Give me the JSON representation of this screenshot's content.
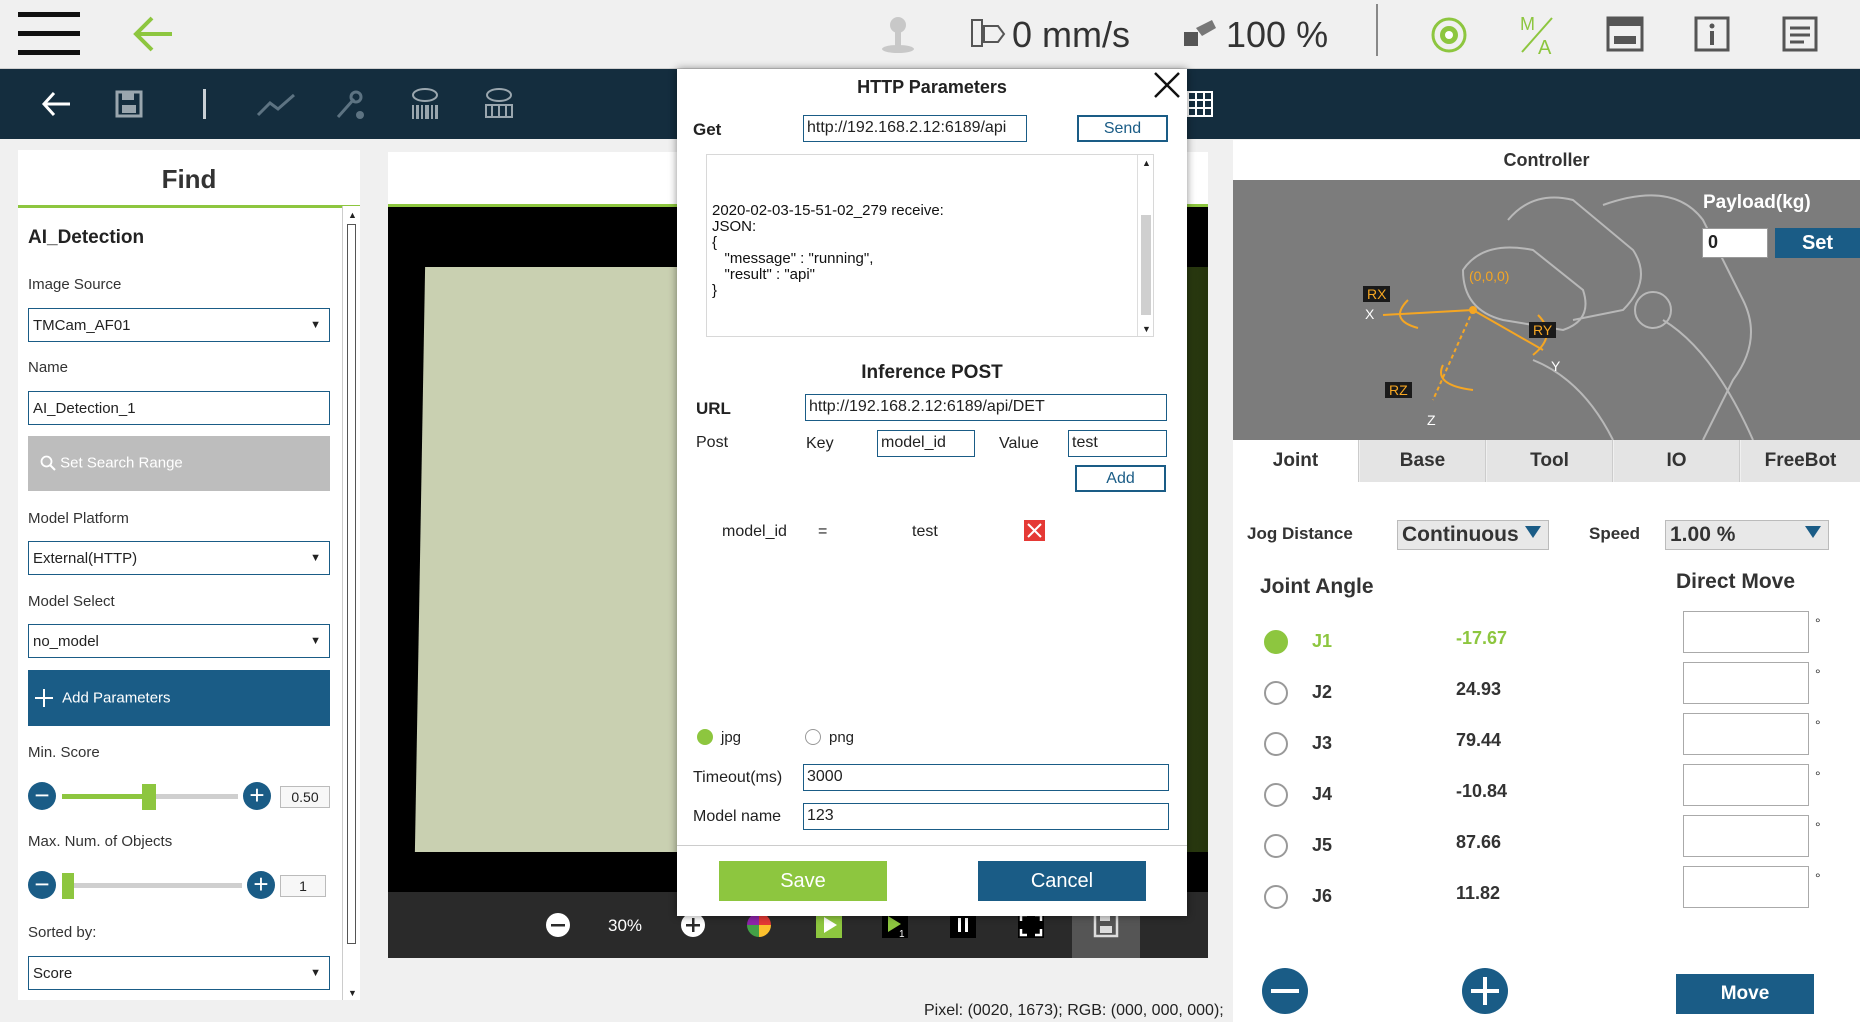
{
  "topbar": {
    "speed_value": "0 mm/s",
    "percent_value": "100 %"
  },
  "find_panel": {
    "title": "Find",
    "section_title": "AI_Detection",
    "image_source_label": "Image Source",
    "image_source_value": "TMCam_AF01",
    "name_label": "Name",
    "name_value": "AI_Detection_1",
    "set_search_range_label": "Set Search Range",
    "model_platform_label": "Model Platform",
    "model_platform_value": "External(HTTP)",
    "model_select_label": "Model Select",
    "model_select_value": "no_model",
    "add_parameters_label": "Add Parameters",
    "min_score_label": "Min. Score",
    "min_score_value": "0.50",
    "max_objects_label": "Max. Num. of Objects",
    "max_objects_value": "1",
    "sorted_by_label": "Sorted by:",
    "sorted_by_value": "Score"
  },
  "viewer": {
    "zoom": "30%"
  },
  "status_bar": {
    "pixel_info": "Pixel: (0020, 1673); RGB: (000, 000, 000);"
  },
  "controller": {
    "title": "Controller",
    "payload_label": "Payload(kg)",
    "payload_value": "0",
    "set_label": "Set",
    "diagram_labels": {
      "rx": "RX",
      "ry": "RY",
      "rz": "RZ",
      "x": "X",
      "y": "Y",
      "z": "Z",
      "origin": "(0,0,0)"
    },
    "tabs": [
      "Joint",
      "Base",
      "Tool",
      "IO",
      "FreeBot"
    ],
    "jog_distance_label": "Jog Distance",
    "jog_distance_value": "Continuous",
    "speed_label": "Speed",
    "speed_value": "1.00 %",
    "joint_angle_label": "Joint Angle",
    "direct_move_label": "Direct Move",
    "joints": [
      {
        "name": "J1",
        "value": "-17.67"
      },
      {
        "name": "J2",
        "value": "24.93"
      },
      {
        "name": "J3",
        "value": "79.44"
      },
      {
        "name": "J4",
        "value": "-10.84"
      },
      {
        "name": "J5",
        "value": "87.66"
      },
      {
        "name": "J6",
        "value": "11.82"
      }
    ],
    "degree_symbol": "°",
    "move_label": "Move"
  },
  "dialog": {
    "title": "HTTP Parameters",
    "get_label": "Get",
    "get_url": "http://192.168.2.12:6189/api",
    "send_label": "Send",
    "response_lines": [
      "2020-02-03-15-51-02_279 receive:",
      "JSON:",
      "{",
      "   \"message\" : \"running\",",
      "   \"result\" : \"api\"",
      "}"
    ],
    "inference_title": "Inference POST",
    "url_label": "URL",
    "post_url": "http://192.168.2.12:6189/api/DET",
    "post_label": "Post",
    "key_label": "Key",
    "key_value": "model_id",
    "value_label": "Value",
    "value_value": "test",
    "add_label": "Add",
    "param_key": "model_id",
    "param_eq": "=",
    "param_value": "test",
    "format_jpg": "jpg",
    "format_png": "png",
    "timeout_label": "Timeout(ms)",
    "timeout_value": "3000",
    "model_name_label": "Model name",
    "model_name_value": "123",
    "save_label": "Save",
    "cancel_label": "Cancel"
  },
  "colors": {
    "accent_green": "#8dc63f",
    "primary_blue": "#1a5c86",
    "toolbar_dark": "#142d3e",
    "diagram_orange": "#f5a623"
  }
}
